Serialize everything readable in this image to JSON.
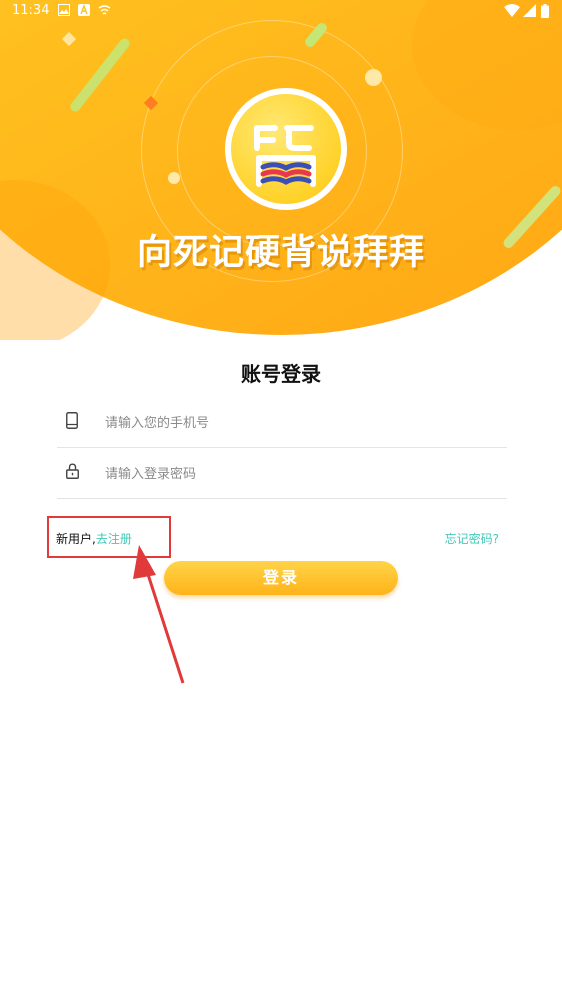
{
  "status_bar": {
    "time": "11:34",
    "icons": [
      "image-icon",
      "a-icon",
      "wireless-icon",
      "wifi-icon",
      "signal-icon",
      "battery-icon"
    ]
  },
  "hero": {
    "slogan": "向死记硬背说拜拜",
    "logo_icon": "book-character-logo"
  },
  "form": {
    "title": "账号登录",
    "phone_placeholder": "请输入您的手机号",
    "password_placeholder": "请输入登录密码",
    "new_user_text": "新用户,",
    "register_link": "去注册",
    "forgot_link": "忘记密码?",
    "login_button": "登录"
  },
  "colors": {
    "brand_yellow": "#ffc21a",
    "accent_teal": "#41c9b6",
    "annotation_red": "#e03a3a"
  }
}
